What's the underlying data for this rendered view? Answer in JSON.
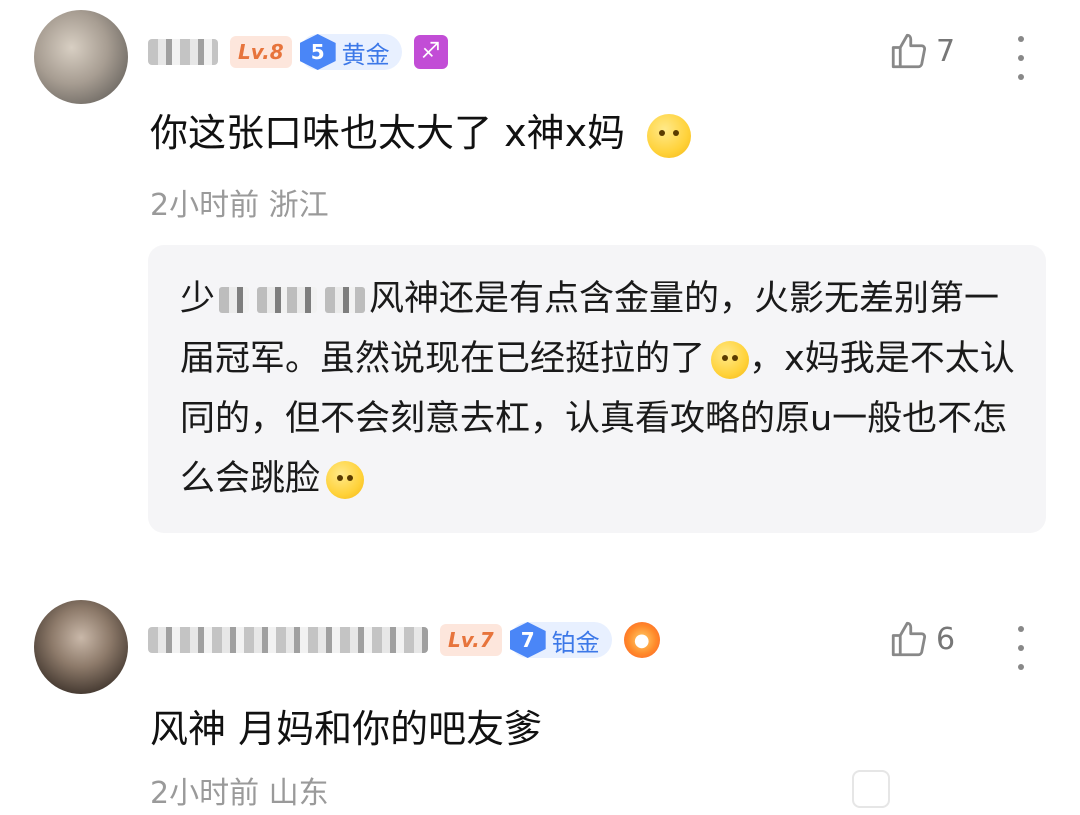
{
  "comments": [
    {
      "level": "Lv.8",
      "rank_num": "5",
      "rank_label": "黄金",
      "zodiac": "♐",
      "likes": "7",
      "text": "你这张口味也太大了 x神x妈",
      "time": "2小时前",
      "location": "浙江",
      "quote": {
        "start": "少",
        "text": "风神还是有点含金量的，火影无差别第一届冠军。虽然说现在已经挺拉的了",
        "text2": "，x妈我是不太认同的，但不会刻意去杠，认真看攻略的原u一般也不怎么会跳脸"
      }
    },
    {
      "level": "Lv.7",
      "rank_num": "7",
      "rank_label": "铂金",
      "likes": "6",
      "text": "风神 月妈和你的吧友爹",
      "time": "2小时前",
      "location": "山东"
    }
  ],
  "icons": {
    "like": "thumbs-up-icon",
    "more": "more-vertical-icon",
    "emoji": "smiley-emoji-icon"
  },
  "colors": {
    "level_bg": "#fde6dc",
    "level_text": "#e7743c",
    "rank_blue": "#4a86f7",
    "meta_gray": "#9a9a9a",
    "quote_bg": "#f5f5f7"
  }
}
